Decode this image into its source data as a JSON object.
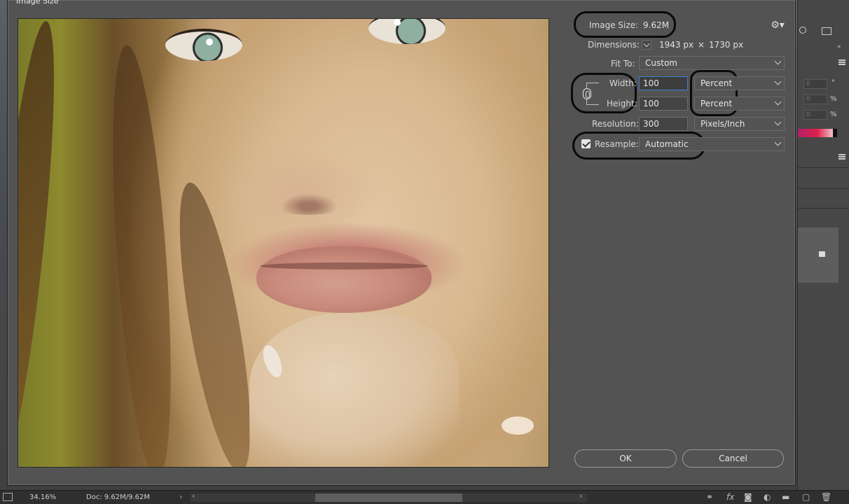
{
  "dialog": {
    "title": "Image Size",
    "image_size_label": "Image Size:",
    "image_size_value": "9.62M",
    "dimensions_label": "Dimensions:",
    "dimensions_width": "1943 px",
    "dimensions_times": "×",
    "dimensions_height": "1730 px",
    "fit_to_label": "Fit To:",
    "fit_to_value": "Custom",
    "width_label": "Width:",
    "width_value": "100",
    "width_unit": "Percent",
    "height_label": "Height:",
    "height_value": "100",
    "height_unit": "Percent",
    "resolution_label": "Resolution:",
    "resolution_value": "300",
    "resolution_unit": "Pixels/Inch",
    "resample_label": "Resample:",
    "resample_checked": true,
    "resample_value": "Automatic",
    "ok_label": "OK",
    "cancel_label": "Cancel",
    "gear_icon": "gear-icon"
  },
  "right_panel": {
    "unit_degree": "°",
    "unit_percent_1": "%",
    "unit_percent_2": "%",
    "input_value_1": "0",
    "input_value_2": "0",
    "input_value_3": "0"
  },
  "status_bar": {
    "zoom": "34.16%",
    "doc": "Doc: 9.62M/9.62M"
  },
  "colors": {
    "dialog_bg": "#535353",
    "focus_border": "#3f7ec9",
    "annotation_marker": "#0a0a0a"
  }
}
